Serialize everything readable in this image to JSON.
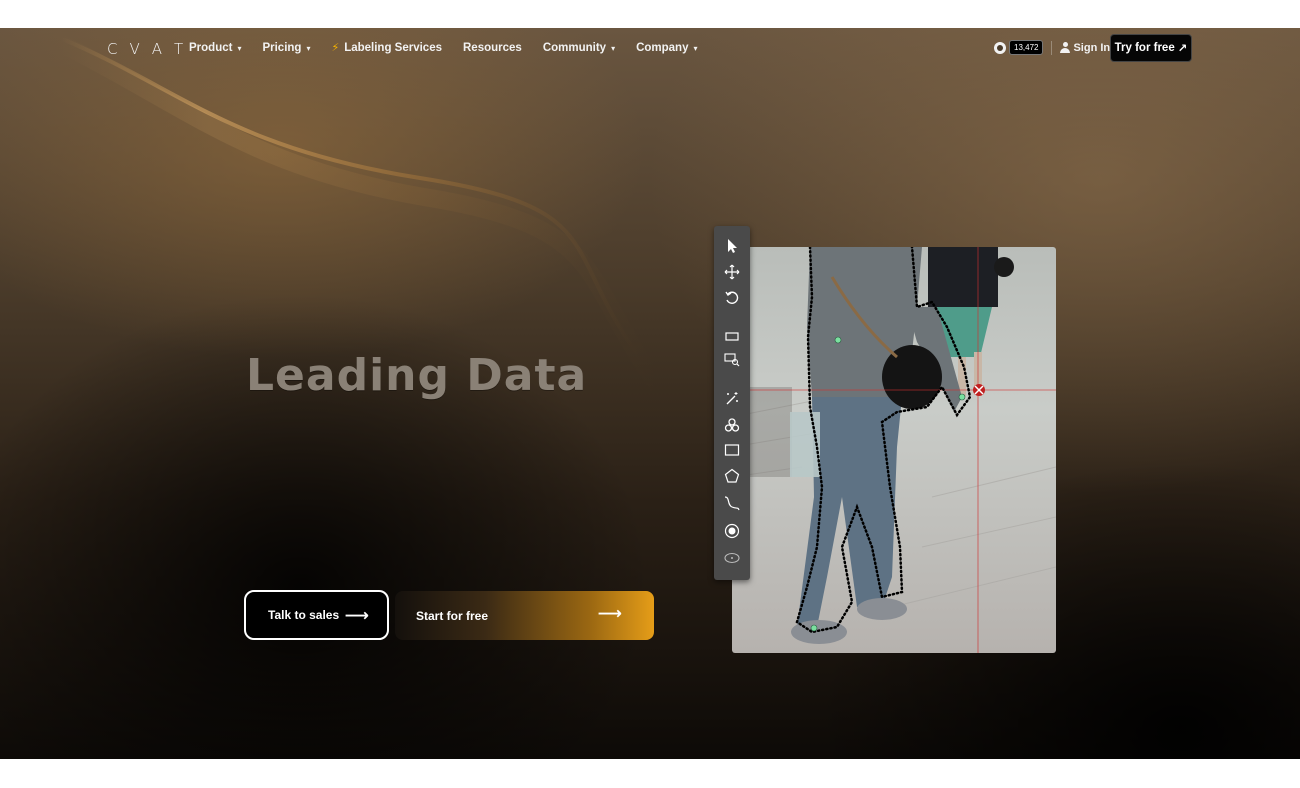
{
  "nav": {
    "logo_letters": [
      "C",
      "V",
      "A",
      "T"
    ],
    "links": [
      {
        "label": "Product",
        "chevron": true
      },
      {
        "label": "Pricing",
        "chevron": true
      },
      {
        "label": "Labeling Services",
        "chevron": false,
        "icon": "lightning-icon"
      },
      {
        "label": "Resources",
        "chevron": false
      },
      {
        "label": "Community",
        "chevron": true
      },
      {
        "label": "Company",
        "chevron": true
      }
    ],
    "github_stars": "13,472",
    "sign_in_label": "Sign In",
    "try_label": "Try for free"
  },
  "hero": {
    "headline": "Leading Data",
    "talk_to_sales_label": "Talk to sales",
    "start_free_label": "Start for free"
  },
  "toolbar": {
    "tools": [
      "cursor-icon",
      "move-icon",
      "rotate-icon",
      "rectangle-fit-icon",
      "zoom-region-icon",
      "magic-wand-icon",
      "ai-tools-icon",
      "rectangle-icon",
      "polygon-icon",
      "polyline-icon",
      "point-icon",
      "ellipse-icon"
    ]
  },
  "colors": {
    "accent": "#e59d18",
    "headline": "#8a8176",
    "annotation_point": "#7be0a0",
    "crosshair": "#d03030"
  }
}
